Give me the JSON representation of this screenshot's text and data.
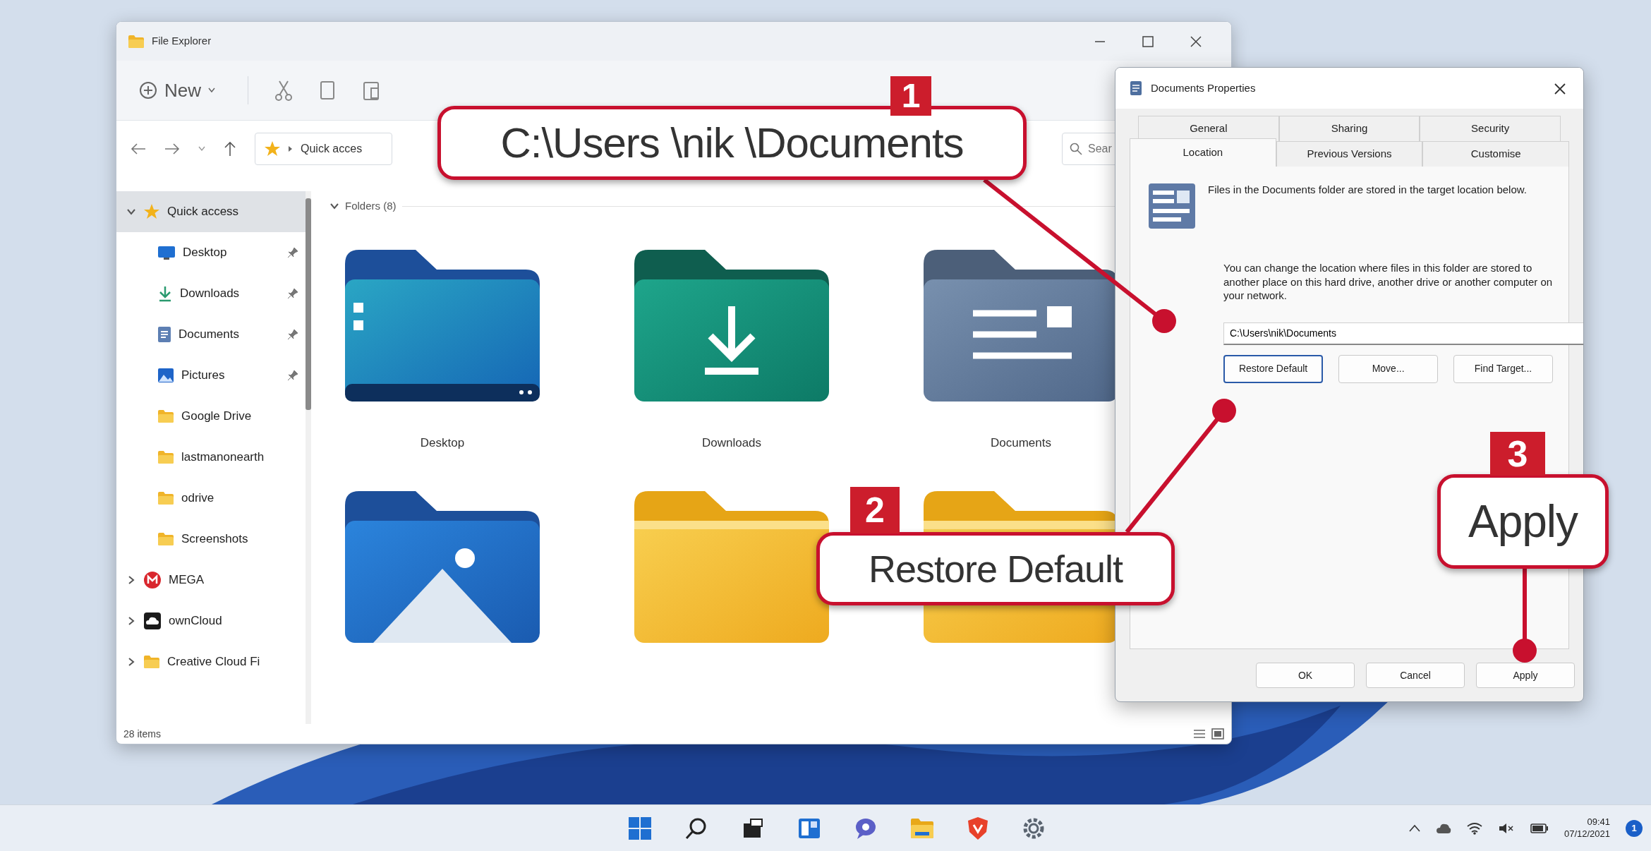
{
  "explorer": {
    "title": "File Explorer",
    "new_label": "New",
    "breadcrumb": "Quick acces",
    "search_placeholder": "Sear",
    "sidebar": [
      {
        "label": "Quick access",
        "kind": "star",
        "expanded": true,
        "selected": true,
        "children": [
          {
            "label": "Desktop",
            "kind": "desktop",
            "pinned": true,
            "selected": false
          },
          {
            "label": "Downloads",
            "kind": "downloads",
            "pinned": true,
            "selected": false
          },
          {
            "label": "Documents",
            "kind": "documents",
            "pinned": true,
            "selected": false
          },
          {
            "label": "Pictures",
            "kind": "pictures",
            "pinned": true,
            "selected": false
          },
          {
            "label": "Google Drive",
            "kind": "folder",
            "pinned": false,
            "selected": false
          },
          {
            "label": "lastmanonearth",
            "kind": "folder",
            "pinned": false,
            "selected": false
          },
          {
            "label": "odrive",
            "kind": "folder",
            "pinned": false,
            "selected": false
          },
          {
            "label": "Screenshots",
            "kind": "folder",
            "pinned": false,
            "selected": false
          }
        ]
      },
      {
        "label": "MEGA",
        "kind": "mega",
        "expanded": false,
        "selected": false
      },
      {
        "label": "ownCloud",
        "kind": "cloud",
        "expanded": false,
        "selected": false
      },
      {
        "label": "Creative Cloud Fi",
        "kind": "folder",
        "expanded": false,
        "selected": false
      }
    ],
    "section": {
      "title": "Folders (8)",
      "expanded": true
    },
    "folders": [
      {
        "label": "Desktop",
        "kind": "desktop"
      },
      {
        "label": "Downloads",
        "kind": "downloads"
      },
      {
        "label": "Documents",
        "kind": "documents"
      },
      {
        "kind": "pictures"
      },
      {
        "kind": "plain"
      },
      {
        "kind": "plain"
      }
    ],
    "status": "28 items"
  },
  "dialog": {
    "title": "Documents Properties",
    "tab_rows": [
      [
        {
          "label": "General",
          "selected": false
        },
        {
          "label": "Sharing",
          "selected": false
        },
        {
          "label": "Security",
          "selected": false
        }
      ],
      [
        {
          "label": "Location",
          "selected": true
        },
        {
          "label": "Previous Versions",
          "selected": false
        },
        {
          "label": "Customise",
          "selected": false
        }
      ]
    ],
    "intro": "Files in the Documents folder are stored in the target location below.",
    "note": "You can change the location where files in this folder are stored to another place on this hard drive, another drive or another computer on your network.",
    "path": "C:\\Users\\nik\\Documents",
    "buttons": [
      {
        "label": "Restore Default",
        "focused": true
      },
      {
        "label": "Move...",
        "focused": false
      },
      {
        "label": "Find Target...",
        "focused": false
      }
    ],
    "footer_buttons": [
      "OK",
      "Cancel",
      "Apply"
    ]
  },
  "callouts": [
    {
      "number": "1",
      "text": "C:\\Users \\nik \\Documents"
    },
    {
      "number": "2",
      "text": "Restore Default"
    },
    {
      "number": "3",
      "text": "Apply"
    }
  ],
  "taskbar": {
    "time": "09:41",
    "date": "07/12/2021",
    "notification_count": "1"
  }
}
